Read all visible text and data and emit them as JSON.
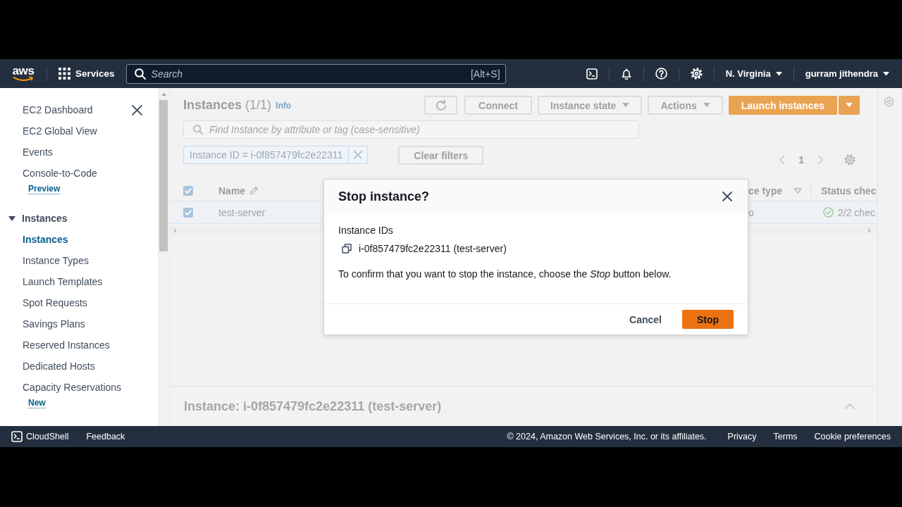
{
  "top_bar": {
    "logo": "aws",
    "services": "Services",
    "search": {
      "placeholder": "Search",
      "shortcut": "[Alt+S]"
    },
    "region": "N. Virginia",
    "account": "gurram jithendra"
  },
  "sidebar": {
    "items": [
      {
        "label": "EC2 Dashboard",
        "selected": false
      },
      {
        "label": "EC2 Global View",
        "selected": false
      },
      {
        "label": "Events",
        "selected": false
      },
      {
        "label": "Console-to-Code",
        "selected": false,
        "badge": "Preview"
      }
    ],
    "sections": [
      {
        "title": "Instances",
        "expanded": true,
        "items": [
          {
            "label": "Instances",
            "selected": true
          },
          {
            "label": "Instance Types",
            "selected": false
          },
          {
            "label": "Launch Templates",
            "selected": false
          },
          {
            "label": "Spot Requests",
            "selected": false
          },
          {
            "label": "Savings Plans",
            "selected": false
          },
          {
            "label": "Reserved Instances",
            "selected": false
          },
          {
            "label": "Dedicated Hosts",
            "selected": false
          },
          {
            "label": "Capacity Reservations",
            "selected": false,
            "badge": "New"
          }
        ]
      }
    ]
  },
  "instances": {
    "title": "Instances",
    "count": "(1/1)",
    "info": "Info",
    "actions": [
      {
        "kind": "refresh"
      },
      {
        "kind": "button",
        "label": "Connect"
      },
      {
        "kind": "dropdown",
        "label": "Instance state"
      },
      {
        "kind": "dropdown",
        "label": "Actions"
      },
      {
        "kind": "split",
        "label": "Launch instances"
      }
    ],
    "search": {
      "placeholder": "Find Instance by attribute or tag (case-sensitive)"
    },
    "filter": "Instance ID = i-0f857479fc2e22311",
    "clear_filters": "Clear filters",
    "pagination": {
      "pages": [
        {
          "label": "1",
          "selected": true
        }
      ]
    },
    "table": {
      "all_checked": true,
      "columns": [
        {
          "label": "Name",
          "kind": "editable"
        },
        {
          "label": "ce type",
          "kind": "sortable"
        },
        {
          "label": "Status chec",
          "kind": "plain"
        }
      ],
      "rows": [
        {
          "selected": true,
          "checked": true,
          "cells": [
            {
              "kind": "text",
              "text": "test-server"
            },
            {
              "kind": "text",
              "text": "o"
            },
            {
              "kind": "status",
              "text": "2/2 chec"
            }
          ]
        }
      ]
    }
  },
  "details": {
    "title": "Instance: i-0f857479fc2e22311 (test-server)",
    "expanded": false
  },
  "dialog": {
    "title": "Stop instance?",
    "field_label": "Instance IDs",
    "instance": "i-0f857479fc2e22311 (test-server)",
    "message": "To confirm that you want to stop the instance, choose the *Stop* button below.",
    "buttons": [
      {
        "kind": "link",
        "label": "Cancel"
      },
      {
        "kind": "primary",
        "label": "Stop"
      }
    ]
  },
  "footer": {
    "cloudshell": "CloudShell",
    "feedback": "Feedback",
    "copyright": "© 2024, Amazon Web Services, Inc. or its affiliates.",
    "links": [
      "Privacy",
      "Terms",
      "Cookie preferences"
    ]
  }
}
